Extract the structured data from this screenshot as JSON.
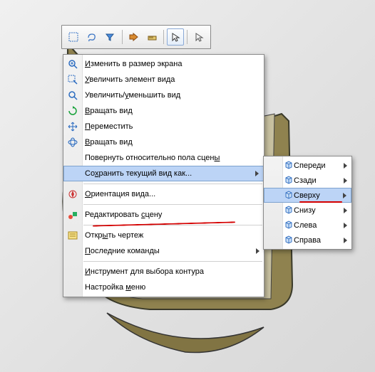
{
  "toolbar": {
    "icons": [
      {
        "name": "select-box-icon",
        "active": false
      },
      {
        "name": "lasso-icon",
        "active": false
      },
      {
        "name": "filter-select-icon",
        "active": false
      },
      {
        "name": "toggle-visibility-icon",
        "active": false
      },
      {
        "name": "measure-icon",
        "active": false
      },
      {
        "name": "cursor-arrow-icon",
        "active": true
      },
      {
        "name": "cursor-plain-icon",
        "active": false
      }
    ]
  },
  "context_menu": {
    "items": [
      {
        "label_pre": "",
        "mnem": "И",
        "label_post": "зменить в размер экрана",
        "has_sub": false,
        "icon": "zoom-fit-icon"
      },
      {
        "label_pre": "",
        "mnem": "У",
        "label_post": "величить элемент вида",
        "has_sub": false,
        "icon": "zoom-area-icon"
      },
      {
        "label_pre": "Увеличить/",
        "mnem": "у",
        "label_post": "меньшить вид",
        "has_sub": false,
        "icon": "zoom-io-icon"
      },
      {
        "label_pre": "",
        "mnem": "В",
        "label_post": "ращать вид",
        "has_sub": false,
        "icon": "rotate-icon"
      },
      {
        "label_pre": "",
        "mnem": "П",
        "label_post": "ереместить",
        "has_sub": false,
        "icon": "pan-icon"
      },
      {
        "label_pre": "",
        "mnem": "В",
        "label_post": "ращать вид",
        "has_sub": false,
        "icon": "spin-icon"
      },
      {
        "label_pre": "Повернуть относительно пола сцен",
        "mnem": "ы",
        "label_post": "",
        "has_sub": false,
        "icon": ""
      },
      {
        "label_pre": "Со",
        "mnem": "х",
        "label_post": "ранить текущий вид как...",
        "has_sub": true,
        "icon": "",
        "highlight": true
      },
      {
        "divider": true
      },
      {
        "label_pre": "",
        "mnem": "О",
        "label_post": "риентация вида...",
        "has_sub": false,
        "icon": "compass-icon"
      },
      {
        "divider": true
      },
      {
        "label_pre": "Редактировать ",
        "mnem": "с",
        "label_post": "цену",
        "has_sub": false,
        "icon": "scene-icon"
      },
      {
        "divider": true
      },
      {
        "label_pre": "Откр",
        "mnem": "ы",
        "label_post": "ть чертеж",
        "has_sub": false,
        "icon": "drawing-icon"
      },
      {
        "label_pre": "",
        "mnem": "П",
        "label_post": "оследние команды",
        "has_sub": true,
        "icon": ""
      },
      {
        "divider": true
      },
      {
        "label_pre": "",
        "mnem": "И",
        "label_post": "нструмент для выбора контура",
        "has_sub": false,
        "icon": ""
      },
      {
        "label_pre": "Настройка ",
        "mnem": "м",
        "label_post": "еню",
        "has_sub": false,
        "icon": ""
      }
    ]
  },
  "submenu": {
    "items": [
      {
        "label": "Спереди",
        "highlight": false,
        "icon": "view-front-icon"
      },
      {
        "label": "Сзади",
        "highlight": false,
        "icon": "view-back-icon"
      },
      {
        "label": "Сверху",
        "highlight": true,
        "icon": "view-top-icon"
      },
      {
        "label": "Снизу",
        "highlight": false,
        "icon": "view-bottom-icon"
      },
      {
        "label": "Слева",
        "highlight": false,
        "icon": "view-left-icon"
      },
      {
        "label": "Справа",
        "highlight": false,
        "icon": "view-right-icon"
      }
    ]
  }
}
